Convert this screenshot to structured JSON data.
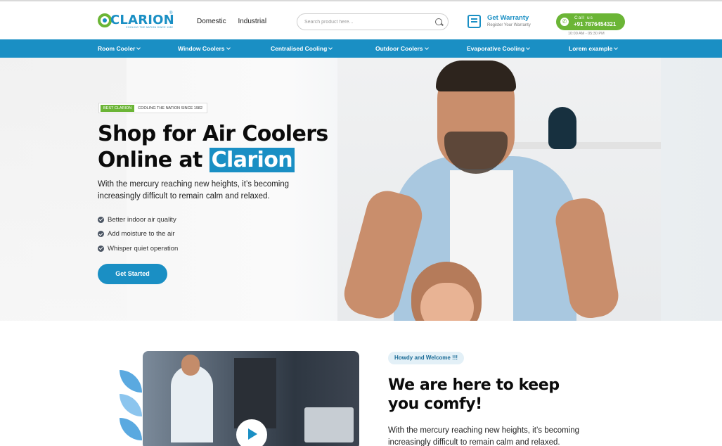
{
  "header": {
    "logo_text": "CLARION",
    "logo_tagline": "COOLING THE NATION SINCE 1982",
    "logo_reg": "®",
    "nav": [
      "Domestic",
      "Industrial"
    ],
    "search_placeholder": "Search product here...",
    "warranty_title": "Get Warranty",
    "warranty_sub": "Register Your Warranty",
    "call_label": "Call us",
    "call_number": "+91 7876454321",
    "call_hours": "10:00 AM - 05:30 PM"
  },
  "categories": [
    "Room Cooler",
    "Window Coolers",
    "Centralised Cooling",
    "Outdoor Coolers",
    "Evaporative Cooling",
    "Lorem example"
  ],
  "hero": {
    "badge_green": "BEST CLARION",
    "badge_text": "COOLING THE NATION SINCE 1982",
    "title_line1": "Shop for Air Coolers",
    "title_line2_prefix": "Online at ",
    "title_highlight": "Clarion",
    "description": "With the mercury reaching new heights, it’s becoming increasingly difficult to remain calm and relaxed.",
    "features": [
      "Better indoor air quality",
      "Add moisture to the air",
      "Whisper quiet operation"
    ],
    "cta_label": "Get Started"
  },
  "welcome": {
    "tag": "Howdy and Welcome !!!",
    "title_line1": "We are here to keep",
    "title_line2": "you comfy!",
    "description": "With the mercury reaching new heights, it’s becoming increasingly difficult to remain calm and relaxed."
  },
  "colors": {
    "brand_blue": "#1a8fc4",
    "brand_green": "#6bb536"
  }
}
